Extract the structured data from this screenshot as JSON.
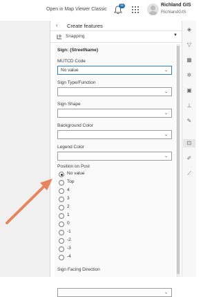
{
  "header": {
    "open_link": "Open in Map Viewer Classic",
    "notification_count": "11",
    "user_name": "Richland GIS",
    "user_id": "RichlandGIS"
  },
  "panel": {
    "title": "Create features",
    "snapping_label": "Snapping",
    "group_heading": "Sign: {StreetName}"
  },
  "fields": {
    "mutcd": {
      "label": "MUTCD Code",
      "value": "No value"
    },
    "sign_type": {
      "label": "Sign Type/Function",
      "value": ""
    },
    "sign_shape": {
      "label": "Sign Shape",
      "value": ""
    },
    "background_color": {
      "label": "Background Color",
      "value": ""
    },
    "legend_color": {
      "label": "Legend Color",
      "value": ""
    },
    "facing": {
      "label": "Sign Facing Direction",
      "value": ""
    }
  },
  "position_on_post": {
    "label": "Position on Post",
    "selected": "No value",
    "options": [
      "No value",
      "Top",
      "4",
      "3",
      "2",
      "1",
      "0",
      "-1",
      "-2",
      "-3",
      "-4"
    ]
  },
  "icons": {
    "bell": "bell-icon",
    "apps": "apps-grid-icon",
    "back": "chevron-left-icon",
    "snapping": "snapping-icon",
    "toolbar": [
      "layers-icon",
      "filter-icon",
      "table-icon",
      "effects-icon",
      "popup-icon",
      "chart-icon",
      "edit-pencil-icon",
      "create-features-icon",
      "sketch-icon",
      "measure-icon"
    ]
  },
  "colors": {
    "accent": "#2f80c1",
    "badge": "#1f6fb2",
    "arrow": "#e8835a"
  }
}
